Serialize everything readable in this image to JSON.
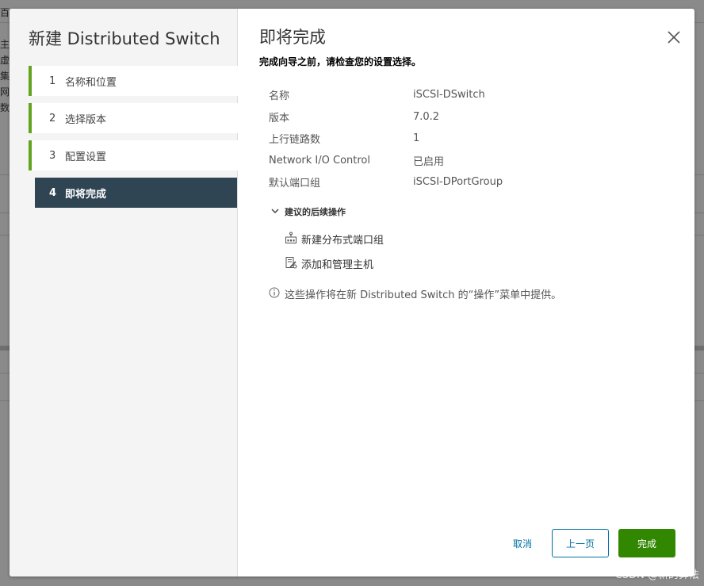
{
  "background": {
    "chars": [
      "百",
      "主",
      "虚",
      "集",
      "网",
      "数"
    ]
  },
  "wizard": {
    "title": "新建 Distributed Switch",
    "steps": [
      {
        "num": "1",
        "label": "名称和位置"
      },
      {
        "num": "2",
        "label": "选择版本"
      },
      {
        "num": "3",
        "label": "配置设置"
      },
      {
        "num": "4",
        "label": "即将完成"
      }
    ]
  },
  "page": {
    "title": "即将完成",
    "subtitle": "完成向导之前，请检查您的设置选择。",
    "summary": [
      {
        "key": "名称",
        "value": "iSCSI-DSwitch"
      },
      {
        "key": "版本",
        "value": "7.0.2"
      },
      {
        "key": "上行链路数",
        "value": "1"
      },
      {
        "key": "Network I/O Control",
        "value": "已启用"
      },
      {
        "key": "默认端口组",
        "value": "iSCSI-DPortGroup"
      }
    ],
    "next_steps": {
      "heading": "建议的后续操作",
      "items": [
        {
          "label": "新建分布式端口组",
          "icon": "new-port-group-icon"
        },
        {
          "label": "添加和管理主机",
          "icon": "manage-hosts-icon"
        }
      ]
    },
    "info": "这些操作将在新 Distributed Switch 的“操作”菜单中提供。"
  },
  "footer": {
    "cancel": "取消",
    "back": "上一页",
    "finish": "完成"
  },
  "watermark": "CSDN @新的算法",
  "colors": {
    "accent": "#0072a3",
    "finish": "#318700",
    "step_done": "#62a420",
    "step_active": "#2f4553"
  }
}
